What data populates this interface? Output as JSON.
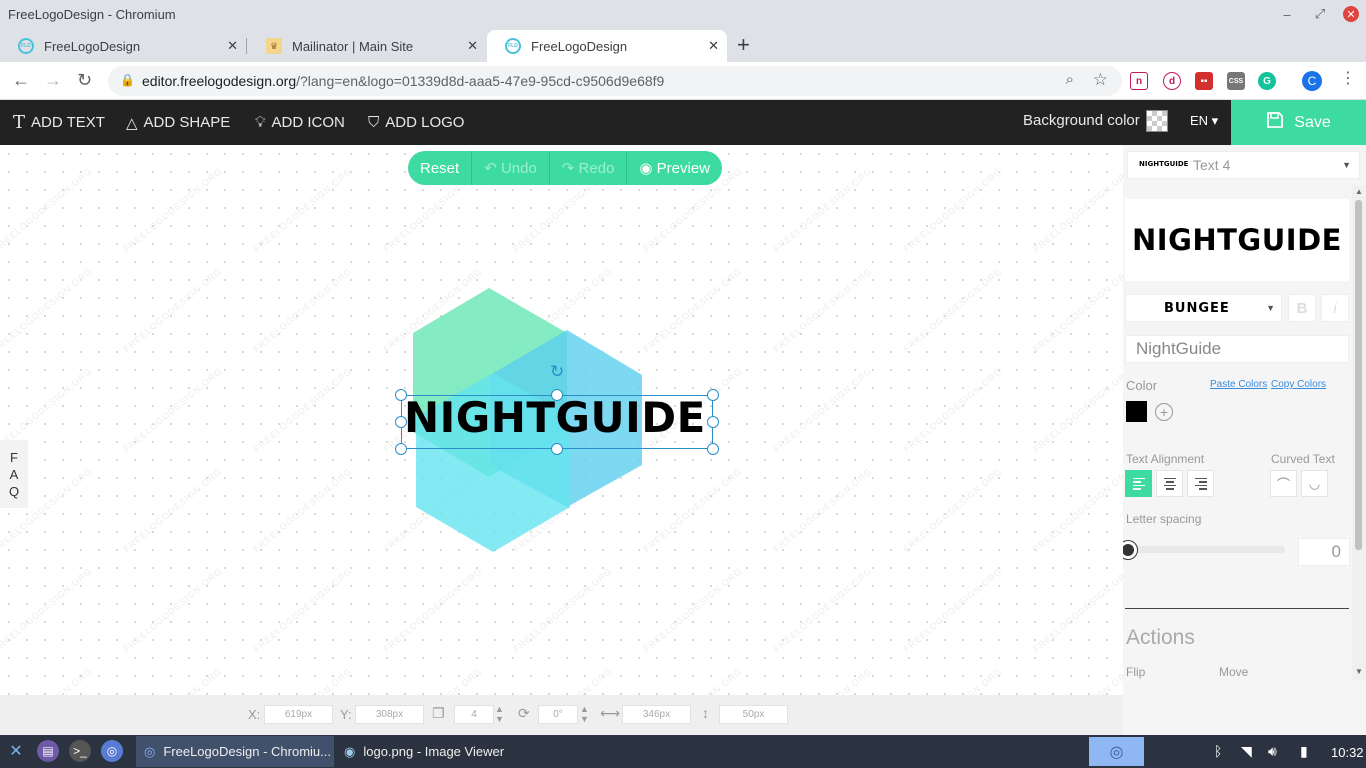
{
  "window": {
    "title": "FreeLogoDesign - Chromium"
  },
  "tabs": [
    {
      "label": "FreeLogoDesign",
      "icon": "freelogodesign-favicon"
    },
    {
      "label": "Mailinator | Main Site",
      "icon": "mailinator-favicon"
    },
    {
      "label": "FreeLogoDesign",
      "icon": "freelogodesign-favicon",
      "active": true
    }
  ],
  "address": {
    "url_host": "editor.freelogodesign.org",
    "url_rest": "/?lang=en&logo=01339d8d-aaa5-47e9-95cd-c9506d9e68f9"
  },
  "extensions": {
    "badge_count": "4",
    "profile_initial": "C"
  },
  "appbar": {
    "add_text": "ADD TEXT",
    "add_shape": "ADD SHAPE",
    "add_icon": "ADD ICON",
    "add_logo": "ADD LOGO",
    "background_color_label": "Background color",
    "lang": "EN ▾",
    "save": "Save"
  },
  "canvas": {
    "controls": {
      "reset": "Reset",
      "undo": "Undo",
      "redo": "Redo",
      "preview": "Preview"
    },
    "faq": [
      "F",
      "A",
      "Q"
    ],
    "logo_text": "NightGuide",
    "watermark": "FREELOGODESIGN.ORG",
    "colors": {
      "accent": "#3ddba2",
      "hex_green": "#6ee7b7",
      "hex_blue": "#5cd0ee",
      "hex_cyan": "#64e3ef"
    }
  },
  "coords": {
    "x_label": "X:",
    "x_value": "619px",
    "y_label": "Y:",
    "y_value": "308px",
    "layer_value": "4",
    "rotation_value": "0°",
    "width_value": "346px",
    "height_value": "50px"
  },
  "panel": {
    "layer_thumb": "NIGHTGUIDE",
    "layer_name": "Text 4",
    "preview_text": "NIGHTGUIDE",
    "font_name": "BUNGEE",
    "bold": "B",
    "italic": "i",
    "text_value": "NightGuide",
    "color_label": "Color",
    "paste_colors": "Paste Colors",
    "copy_colors": "Copy Colors",
    "text_color": "#000000",
    "text_alignment_label": "Text Alignment",
    "curved_text_label": "Curved Text",
    "letter_spacing_label": "Letter spacing",
    "letter_spacing_value": "0",
    "actions_title": "Actions",
    "flip_label": "Flip",
    "move_label": "Move"
  },
  "taskbar": {
    "apps": [
      {
        "label": "FreeLogoDesign - Chromiu...",
        "active": true
      },
      {
        "label": "logo.png - Image Viewer",
        "active": false
      }
    ],
    "clock": "10:32"
  }
}
